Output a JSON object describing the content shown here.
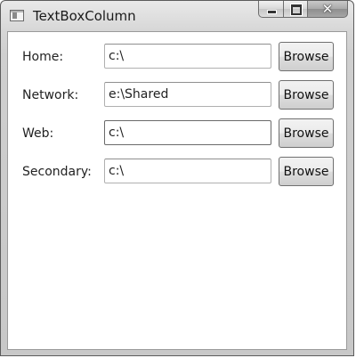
{
  "window": {
    "title": "TextBoxColumn",
    "controls": {
      "minimize": "minimize",
      "maximize": "maximize",
      "close": "close"
    }
  },
  "rows": [
    {
      "label": "Home:",
      "value": "c:\\",
      "button": "Browse"
    },
    {
      "label": "Network:",
      "value": "e:\\Shared",
      "button": "Browse"
    },
    {
      "label": "Web:",
      "value": "c:\\",
      "button": "Browse"
    },
    {
      "label": "Secondary:",
      "value": "c:\\",
      "button": "Browse"
    }
  ]
}
